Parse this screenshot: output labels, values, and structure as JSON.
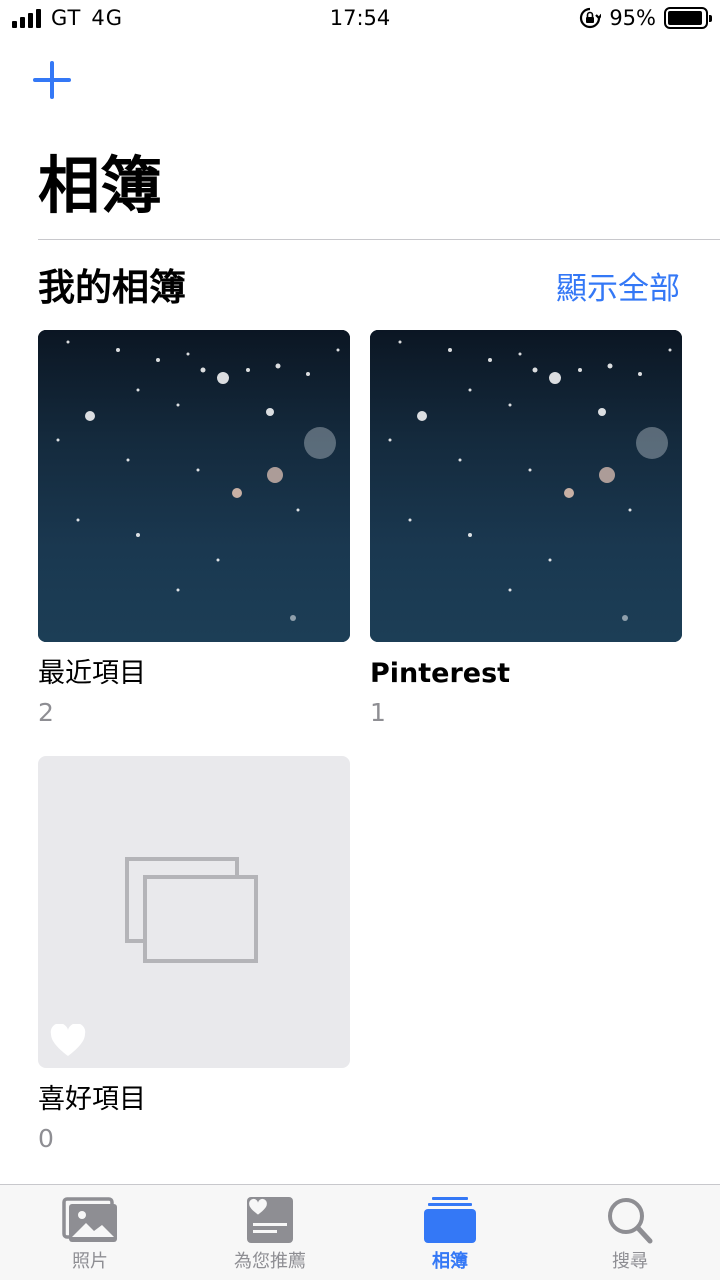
{
  "status_bar": {
    "carrier": "GT",
    "network": "4G",
    "time": "17:54",
    "battery_percent": "95%",
    "battery_level": 0.95
  },
  "nav": {
    "add_icon": "plus-icon",
    "title": "相簿"
  },
  "my_albums": {
    "section_title": "我的相簿",
    "show_all": "顯示全部",
    "albums": [
      {
        "name": "最近項目",
        "count": "2",
        "thumbnail": "ocean-photo"
      },
      {
        "name": "Pinterest",
        "count": "1",
        "thumbnail": "ocean-photo"
      },
      {
        "name": "喜好項目",
        "count": "0",
        "thumbnail": "empty-album-placeholder",
        "badge_icon": "heart-icon"
      }
    ]
  },
  "tab_bar": {
    "tabs": [
      {
        "label": "照片",
        "icon": "photos-icon",
        "active": false
      },
      {
        "label": "為您推薦",
        "icon": "for-you-icon",
        "active": false
      },
      {
        "label": "相簿",
        "icon": "albums-icon",
        "active": true
      },
      {
        "label": "搜尋",
        "icon": "search-icon",
        "active": false
      }
    ]
  },
  "colors": {
    "accent": "#3478f6",
    "secondary_text": "#8e8e93",
    "placeholder_bg": "#e9e9ec"
  }
}
